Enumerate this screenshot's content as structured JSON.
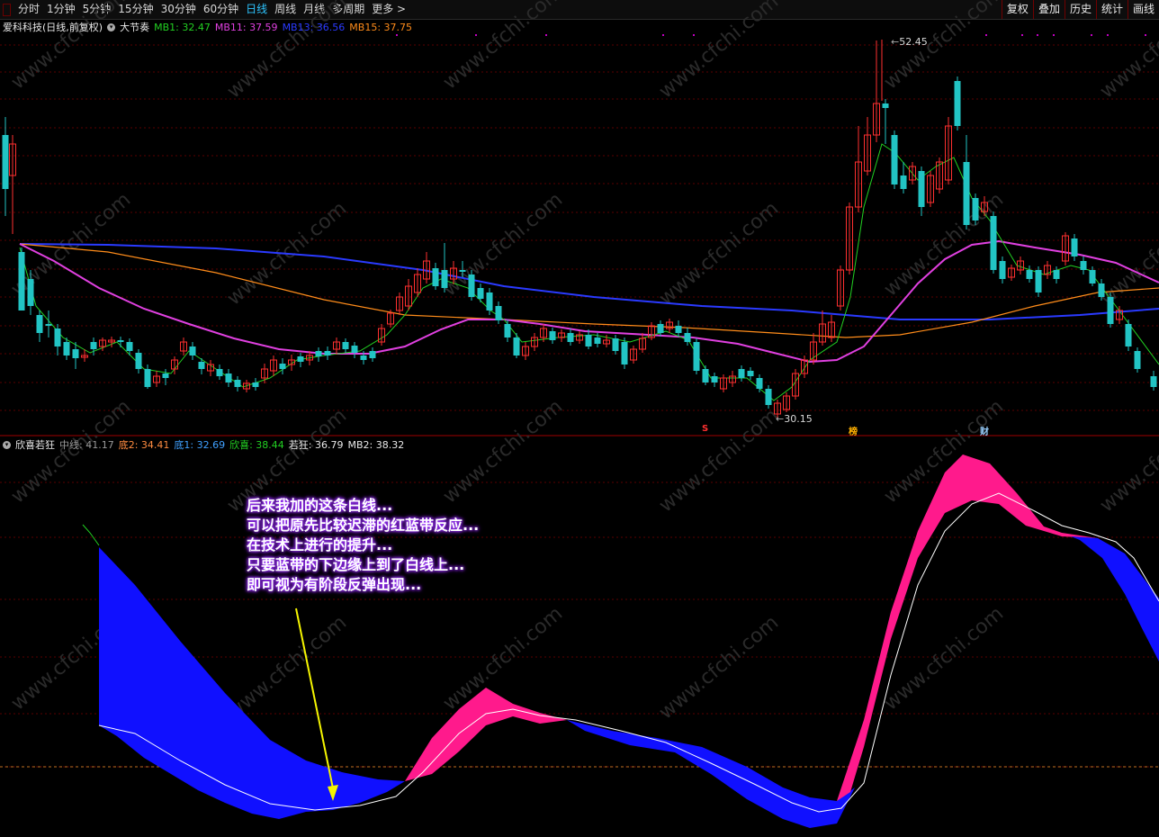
{
  "toolbar": {
    "periods": [
      {
        "label": "分时",
        "active": false
      },
      {
        "label": "1分钟",
        "active": false
      },
      {
        "label": "5分钟",
        "active": false
      },
      {
        "label": "15分钟",
        "active": false
      },
      {
        "label": "30分钟",
        "active": false
      },
      {
        "label": "60分钟",
        "active": false
      },
      {
        "label": "日线",
        "active": true
      },
      {
        "label": "周线",
        "active": false
      },
      {
        "label": "月线",
        "active": false
      },
      {
        "label": "多周期",
        "active": false
      },
      {
        "label": "更多 >",
        "active": false
      }
    ],
    "right_buttons": [
      "复权",
      "叠加",
      "历史",
      "统计",
      "画线"
    ]
  },
  "main_chart": {
    "symbol_title": "爱科科技(日线,前复权)",
    "indicator_name": "大节奏",
    "ma_legend": [
      {
        "label": "MB1: 32.47",
        "color": "#22d022"
      },
      {
        "label": "MB11: 37.59",
        "color": "#e040e0"
      },
      {
        "label": "MB13: 36.56",
        "color": "#2a3aff"
      },
      {
        "label": "MB15: 37.75",
        "color": "#ff8c1a"
      }
    ],
    "high_label": "52.45",
    "low_label": "30.15",
    "markers": [
      {
        "text": "S",
        "color": "#ff3030"
      },
      {
        "text": "榜",
        "color": "#ffb000"
      },
      {
        "text": "财",
        "color": "#9ad0ff"
      }
    ]
  },
  "sub_chart": {
    "indicator_name": "欣喜若狂",
    "legend": [
      {
        "label": "中线: 41.17",
        "color": "#9a9a9a"
      },
      {
        "label": "底2: 34.41",
        "color": "#ff8c40"
      },
      {
        "label": "底1: 32.69",
        "color": "#3fa0ff"
      },
      {
        "label": "欣喜: 38.44",
        "color": "#22d022"
      },
      {
        "label": "若狂: 36.79",
        "color": "#e8e8e8"
      },
      {
        "label": "MB2: 38.32",
        "color": "#e8e8e8"
      }
    ]
  },
  "annotation": {
    "lines": [
      "后来我加的这条白线...",
      "可以把原先比较迟滞的红蓝带反应...",
      "在技术上进行的提升...",
      "只要蓝带的下边缘上到了白线上...",
      "即可视为有阶段反弹出现..."
    ]
  },
  "watermark": "www.cfchi.com",
  "colors": {
    "up_candle": "#ff3030",
    "down_candle": "#22c4c4",
    "ma_short": "#22d022",
    "ma_mid": "#e040e0",
    "ma_long": "#2a3aff",
    "ma_orange": "#ff8c1a",
    "band_red": "#ff1a8c",
    "band_blue": "#1010ff",
    "white_line": "#ffffff",
    "arrow": "#f5f500"
  }
}
